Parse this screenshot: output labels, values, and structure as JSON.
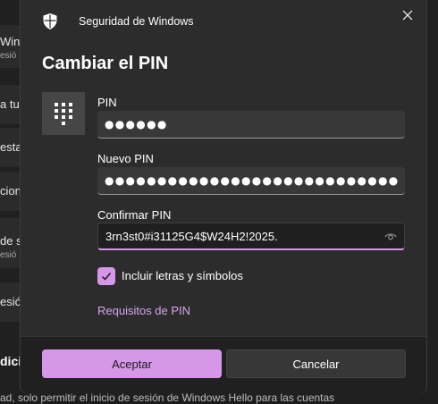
{
  "background": {
    "rows": [
      {
        "title": "Wind",
        "subtitle": "esió"
      },
      {
        "title": "a tu",
        "subtitle": ""
      },
      {
        "title": "esta",
        "subtitle": ""
      },
      {
        "title": "cion",
        "subtitle": ""
      },
      {
        "title": "de s",
        "subtitle": "esió"
      },
      {
        "title": "esió",
        "subtitle": ""
      }
    ],
    "section_heading": "dici",
    "bottom_text": "ad, solo permitir el inicio de sesión de Windows Hello para las cuentas"
  },
  "dialog": {
    "app_title": "Seguridad de Windows",
    "title": "Cambiar el PIN",
    "fields": {
      "pin": {
        "label": "PIN",
        "masked_value": "●●●●●●"
      },
      "new_pin": {
        "label": "Nuevo PIN",
        "masked_value": "●●●●●●●●●●●●●●●●●●●●●●●●●●●●"
      },
      "confirm_pin": {
        "label": "Confirmar PIN",
        "value": "3rn3st0#i31125G4$W24H2!2025."
      }
    },
    "checkbox": {
      "label": "Incluir letras y símbolos",
      "checked": true
    },
    "requirements_link": "Requisitos de PIN",
    "buttons": {
      "accept": "Aceptar",
      "cancel": "Cancelar"
    }
  },
  "icons": {
    "app": "shield-icon",
    "close": "close-icon",
    "keypad": "keypad-icon",
    "reveal": "eye-icon",
    "check": "checkmark-icon"
  },
  "colors": {
    "accent": "#d797e8",
    "dialog_bg": "#2c2c2c",
    "link": "#d9a3f0"
  }
}
